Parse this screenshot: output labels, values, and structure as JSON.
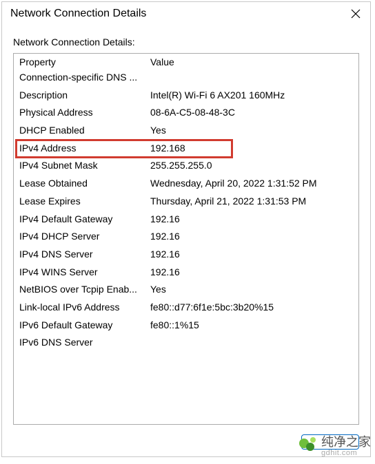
{
  "window": {
    "title": "Network Connection Details",
    "subtitle": "Network Connection Details:"
  },
  "header": {
    "property": "Property",
    "value": "Value"
  },
  "rows": [
    {
      "prop": "Connection-specific DNS ...",
      "val": ""
    },
    {
      "prop": "Description",
      "val": "Intel(R) Wi-Fi 6 AX201 160MHz"
    },
    {
      "prop": "Physical Address",
      "val": "08-6A-C5-08-48-3C"
    },
    {
      "prop": "DHCP Enabled",
      "val": "Yes"
    },
    {
      "prop": "IPv4 Address",
      "val": "192.168"
    },
    {
      "prop": "IPv4 Subnet Mask",
      "val": "255.255.255.0"
    },
    {
      "prop": "Lease Obtained",
      "val": "Wednesday, April 20, 2022 1:31:52 PM"
    },
    {
      "prop": "Lease Expires",
      "val": "Thursday, April 21, 2022 1:31:53 PM"
    },
    {
      "prop": "IPv4 Default Gateway",
      "val": "192.16"
    },
    {
      "prop": "IPv4 DHCP Server",
      "val": "192.16"
    },
    {
      "prop": "IPv4 DNS Server",
      "val": "192.16"
    },
    {
      "prop": "IPv4 WINS Server",
      "val": "192.16"
    },
    {
      "prop": "NetBIOS over Tcpip Enab...",
      "val": "Yes"
    },
    {
      "prop": "Link-local IPv6 Address",
      "val": "fe80::d77:6f1e:5bc:3b20%15"
    },
    {
      "prop": "IPv6 Default Gateway",
      "val": "fe80::1%15"
    },
    {
      "prop": "IPv6 DNS Server",
      "val": ""
    }
  ],
  "watermark": {
    "text": "纯净之家",
    "sub": "gdhit.com"
  },
  "highlight_row_index": 4
}
